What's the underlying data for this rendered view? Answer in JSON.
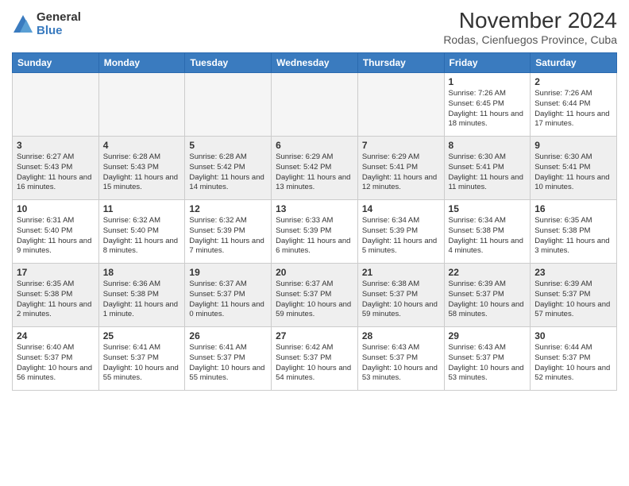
{
  "header": {
    "logo": {
      "general": "General",
      "blue": "Blue"
    },
    "title": "November 2024",
    "subtitle": "Rodas, Cienfuegos Province, Cuba"
  },
  "weekdays": [
    "Sunday",
    "Monday",
    "Tuesday",
    "Wednesday",
    "Thursday",
    "Friday",
    "Saturday"
  ],
  "weeks": [
    {
      "shaded": false,
      "days": [
        {
          "num": "",
          "empty": true
        },
        {
          "num": "",
          "empty": true
        },
        {
          "num": "",
          "empty": true
        },
        {
          "num": "",
          "empty": true
        },
        {
          "num": "",
          "empty": true
        },
        {
          "num": "1",
          "sunrise": "Sunrise: 7:26 AM",
          "sunset": "Sunset: 6:45 PM",
          "daylight": "Daylight: 11 hours and 18 minutes."
        },
        {
          "num": "2",
          "sunrise": "Sunrise: 7:26 AM",
          "sunset": "Sunset: 6:44 PM",
          "daylight": "Daylight: 11 hours and 17 minutes."
        }
      ]
    },
    {
      "shaded": true,
      "days": [
        {
          "num": "3",
          "sunrise": "Sunrise: 6:27 AM",
          "sunset": "Sunset: 5:43 PM",
          "daylight": "Daylight: 11 hours and 16 minutes."
        },
        {
          "num": "4",
          "sunrise": "Sunrise: 6:28 AM",
          "sunset": "Sunset: 5:43 PM",
          "daylight": "Daylight: 11 hours and 15 minutes."
        },
        {
          "num": "5",
          "sunrise": "Sunrise: 6:28 AM",
          "sunset": "Sunset: 5:42 PM",
          "daylight": "Daylight: 11 hours and 14 minutes."
        },
        {
          "num": "6",
          "sunrise": "Sunrise: 6:29 AM",
          "sunset": "Sunset: 5:42 PM",
          "daylight": "Daylight: 11 hours and 13 minutes."
        },
        {
          "num": "7",
          "sunrise": "Sunrise: 6:29 AM",
          "sunset": "Sunset: 5:41 PM",
          "daylight": "Daylight: 11 hours and 12 minutes."
        },
        {
          "num": "8",
          "sunrise": "Sunrise: 6:30 AM",
          "sunset": "Sunset: 5:41 PM",
          "daylight": "Daylight: 11 hours and 11 minutes."
        },
        {
          "num": "9",
          "sunrise": "Sunrise: 6:30 AM",
          "sunset": "Sunset: 5:41 PM",
          "daylight": "Daylight: 11 hours and 10 minutes."
        }
      ]
    },
    {
      "shaded": false,
      "days": [
        {
          "num": "10",
          "sunrise": "Sunrise: 6:31 AM",
          "sunset": "Sunset: 5:40 PM",
          "daylight": "Daylight: 11 hours and 9 minutes."
        },
        {
          "num": "11",
          "sunrise": "Sunrise: 6:32 AM",
          "sunset": "Sunset: 5:40 PM",
          "daylight": "Daylight: 11 hours and 8 minutes."
        },
        {
          "num": "12",
          "sunrise": "Sunrise: 6:32 AM",
          "sunset": "Sunset: 5:39 PM",
          "daylight": "Daylight: 11 hours and 7 minutes."
        },
        {
          "num": "13",
          "sunrise": "Sunrise: 6:33 AM",
          "sunset": "Sunset: 5:39 PM",
          "daylight": "Daylight: 11 hours and 6 minutes."
        },
        {
          "num": "14",
          "sunrise": "Sunrise: 6:34 AM",
          "sunset": "Sunset: 5:39 PM",
          "daylight": "Daylight: 11 hours and 5 minutes."
        },
        {
          "num": "15",
          "sunrise": "Sunrise: 6:34 AM",
          "sunset": "Sunset: 5:38 PM",
          "daylight": "Daylight: 11 hours and 4 minutes."
        },
        {
          "num": "16",
          "sunrise": "Sunrise: 6:35 AM",
          "sunset": "Sunset: 5:38 PM",
          "daylight": "Daylight: 11 hours and 3 minutes."
        }
      ]
    },
    {
      "shaded": true,
      "days": [
        {
          "num": "17",
          "sunrise": "Sunrise: 6:35 AM",
          "sunset": "Sunset: 5:38 PM",
          "daylight": "Daylight: 11 hours and 2 minutes."
        },
        {
          "num": "18",
          "sunrise": "Sunrise: 6:36 AM",
          "sunset": "Sunset: 5:38 PM",
          "daylight": "Daylight: 11 hours and 1 minute."
        },
        {
          "num": "19",
          "sunrise": "Sunrise: 6:37 AM",
          "sunset": "Sunset: 5:37 PM",
          "daylight": "Daylight: 11 hours and 0 minutes."
        },
        {
          "num": "20",
          "sunrise": "Sunrise: 6:37 AM",
          "sunset": "Sunset: 5:37 PM",
          "daylight": "Daylight: 10 hours and 59 minutes."
        },
        {
          "num": "21",
          "sunrise": "Sunrise: 6:38 AM",
          "sunset": "Sunset: 5:37 PM",
          "daylight": "Daylight: 10 hours and 59 minutes."
        },
        {
          "num": "22",
          "sunrise": "Sunrise: 6:39 AM",
          "sunset": "Sunset: 5:37 PM",
          "daylight": "Daylight: 10 hours and 58 minutes."
        },
        {
          "num": "23",
          "sunrise": "Sunrise: 6:39 AM",
          "sunset": "Sunset: 5:37 PM",
          "daylight": "Daylight: 10 hours and 57 minutes."
        }
      ]
    },
    {
      "shaded": false,
      "days": [
        {
          "num": "24",
          "sunrise": "Sunrise: 6:40 AM",
          "sunset": "Sunset: 5:37 PM",
          "daylight": "Daylight: 10 hours and 56 minutes."
        },
        {
          "num": "25",
          "sunrise": "Sunrise: 6:41 AM",
          "sunset": "Sunset: 5:37 PM",
          "daylight": "Daylight: 10 hours and 55 minutes."
        },
        {
          "num": "26",
          "sunrise": "Sunrise: 6:41 AM",
          "sunset": "Sunset: 5:37 PM",
          "daylight": "Daylight: 10 hours and 55 minutes."
        },
        {
          "num": "27",
          "sunrise": "Sunrise: 6:42 AM",
          "sunset": "Sunset: 5:37 PM",
          "daylight": "Daylight: 10 hours and 54 minutes."
        },
        {
          "num": "28",
          "sunrise": "Sunrise: 6:43 AM",
          "sunset": "Sunset: 5:37 PM",
          "daylight": "Daylight: 10 hours and 53 minutes."
        },
        {
          "num": "29",
          "sunrise": "Sunrise: 6:43 AM",
          "sunset": "Sunset: 5:37 PM",
          "daylight": "Daylight: 10 hours and 53 minutes."
        },
        {
          "num": "30",
          "sunrise": "Sunrise: 6:44 AM",
          "sunset": "Sunset: 5:37 PM",
          "daylight": "Daylight: 10 hours and 52 minutes."
        }
      ]
    }
  ]
}
